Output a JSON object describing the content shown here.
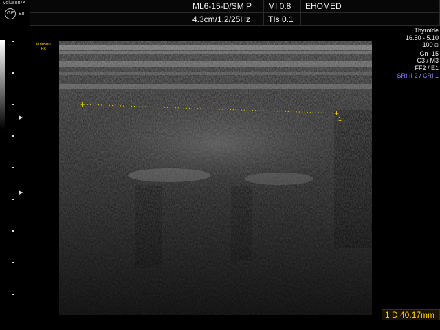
{
  "brand": {
    "wordmark": "Voluson™",
    "logo_text": "GE",
    "model": "E8"
  },
  "header": {
    "probe": "ML6-15-D/SM P",
    "mi": "MI  0.8",
    "operator": "EHOMED",
    "depth": "4.3cm/1.2/25Hz",
    "tis": "TIs  0.1"
  },
  "image_label": {
    "line1": "Voluson",
    "line2": "E8"
  },
  "params": {
    "preset": "Thyroïde",
    "frequency": "16.50 - 5.10",
    "power": "100",
    "gain": "Gn -15",
    "compound": "C3 / M3",
    "filters": "FF2 / E1",
    "sri": "SRI II 2 / CRI 1"
  },
  "measurement": {
    "label": "1  D 40.17mm",
    "caliper_index": "1"
  },
  "colors": {
    "caliper": "#ffd400",
    "sri": "#8c8cff",
    "background": "#000000"
  }
}
